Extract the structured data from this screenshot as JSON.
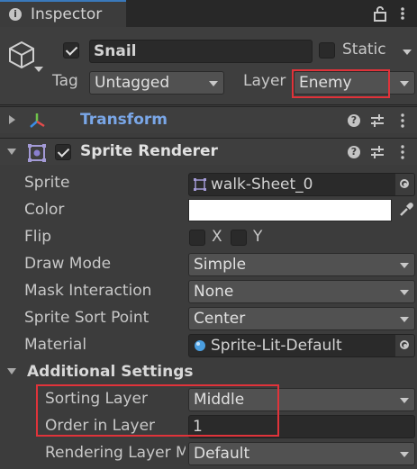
{
  "tab": {
    "title": "Inspector"
  },
  "object": {
    "active": true,
    "name": "Snail",
    "static_label": "Static",
    "static": false,
    "tag_label": "Tag",
    "tag": "Untagged",
    "layer_label": "Layer",
    "layer": "Enemy"
  },
  "transform": {
    "title": "Transform"
  },
  "sprite_renderer": {
    "title": "Sprite Renderer",
    "enabled": true,
    "fields": {
      "sprite_label": "Sprite",
      "sprite": "walk-Sheet_0",
      "color_label": "Color",
      "color": "#ffffff",
      "flip_label": "Flip",
      "flip_x": "X",
      "flip_y": "Y",
      "draw_mode_label": "Draw Mode",
      "draw_mode": "Simple",
      "mask_label": "Mask Interaction",
      "mask": "None",
      "sort_point_label": "Sprite Sort Point",
      "sort_point": "Center",
      "material_label": "Material",
      "material": "Sprite-Lit-Default"
    },
    "additional": {
      "title": "Additional Settings",
      "sorting_layer_label": "Sorting Layer",
      "sorting_layer": "Middle",
      "order_label": "Order in Layer",
      "order": "1",
      "rendering_layer_label": "Rendering Layer M",
      "rendering_layer": "Default"
    }
  },
  "colors": {
    "highlight": "#e0333a",
    "transform_title": "#7aa7e8"
  }
}
